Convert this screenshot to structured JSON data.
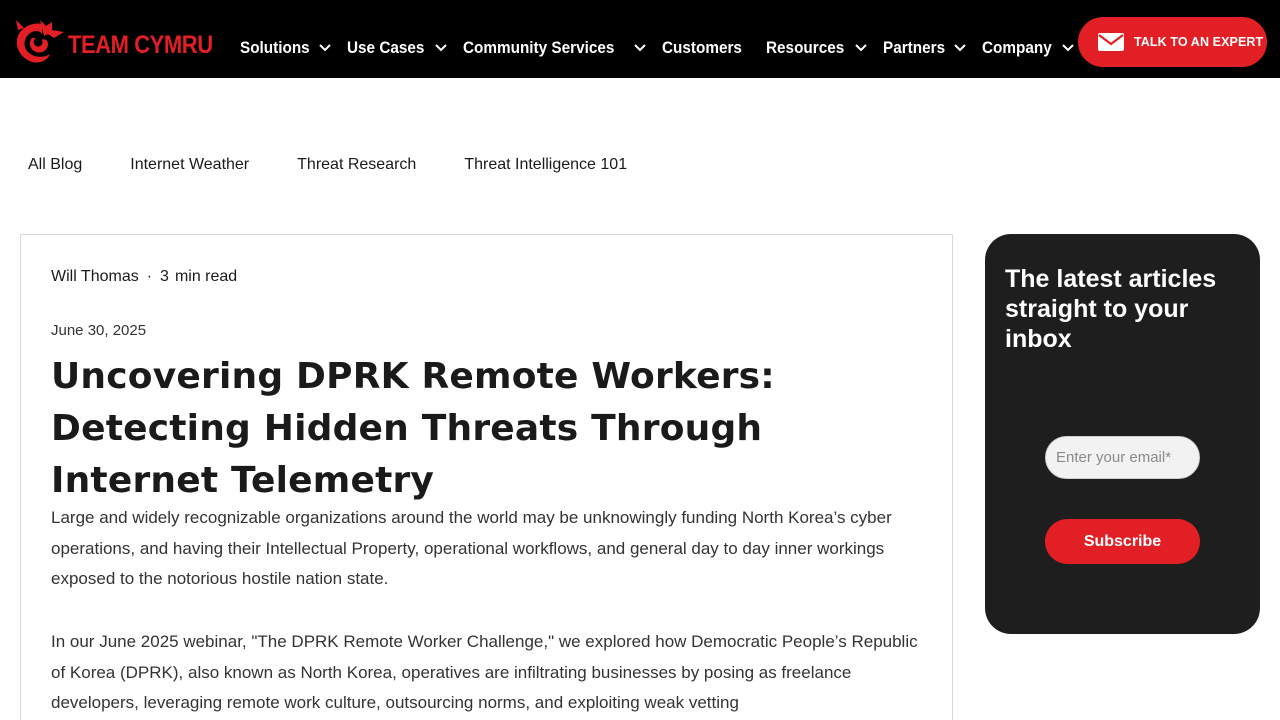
{
  "brand": {
    "name": "TEAM CYMRU",
    "logo_icon": "dragon-icon",
    "accent": "#e31f26"
  },
  "nav": {
    "items": [
      {
        "label": "Solutions",
        "has_dropdown": true
      },
      {
        "label": "Use Cases",
        "has_dropdown": true
      },
      {
        "label": "Community Services",
        "has_dropdown": true
      },
      {
        "label": "Customers",
        "has_dropdown": false
      },
      {
        "label": "Resources",
        "has_dropdown": true
      },
      {
        "label": "Partners",
        "has_dropdown": true
      },
      {
        "label": "Company",
        "has_dropdown": true
      }
    ],
    "cta": {
      "label": "TALK TO AN EXPERT",
      "icon": "mail-icon"
    }
  },
  "categories": [
    "All Blog",
    "Internet Weather",
    "Threat Research",
    "Threat Intelligence 101"
  ],
  "post": {
    "author": "Will Thomas",
    "read_time": "3",
    "read_time_unit": "min read",
    "date": "June 30, 2025",
    "title": "Uncovering DPRK Remote Workers: Detecting Hidden Threats Through Internet Telemetry",
    "paragraphs": [
      "Large and widely recognizable organizations around the world may be unknowingly funding North Korea’s cyber operations, and having their Intellectual Property, operational workflows, and general day to day inner workings exposed to the notorious hostile nation state.",
      "In our June 2025 webinar, \"The DPRK Remote Worker Challenge,\" we explored how Democratic People’s Republic of Korea (DPRK), also known as North Korea, operatives are infiltrating businesses by posing as freelance developers, leveraging remote work culture, outsourcing norms, and exploiting weak vetting"
    ]
  },
  "newsletter": {
    "heading": "The latest articles straight to your inbox",
    "email_placeholder": "Enter your email*",
    "email_value": "",
    "button_label": "Subscribe"
  }
}
